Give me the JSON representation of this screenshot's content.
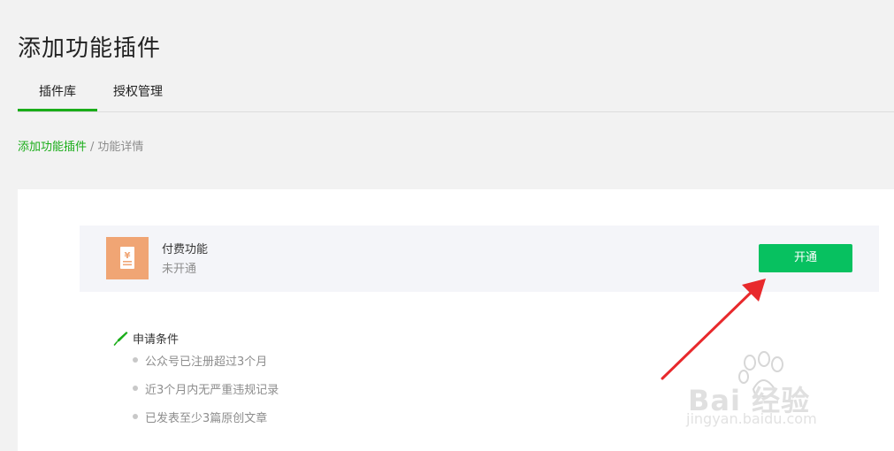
{
  "page": {
    "title": "添加功能插件"
  },
  "tabs": [
    {
      "label": "插件库",
      "active": true
    },
    {
      "label": "授权管理",
      "active": false
    }
  ],
  "breadcrumb": {
    "parent": "添加功能插件",
    "separator": "/",
    "current": "功能详情"
  },
  "plugin": {
    "name": "付费功能",
    "status": "未开通",
    "button_label": "开通",
    "icon": "yuan-receipt-icon"
  },
  "conditions": {
    "title": "申请条件",
    "items": [
      "公众号已注册超过3个月",
      "近3个月内无严重违规记录",
      "已发表至少3篇原创文章"
    ]
  },
  "watermark": {
    "main": "Bai 经验",
    "sub": "jingyan.baidu.com"
  },
  "colors": {
    "accent": "#1aad19",
    "button": "#07c160",
    "icon_bg": "#f0a574",
    "arrow": "#e8292c"
  }
}
